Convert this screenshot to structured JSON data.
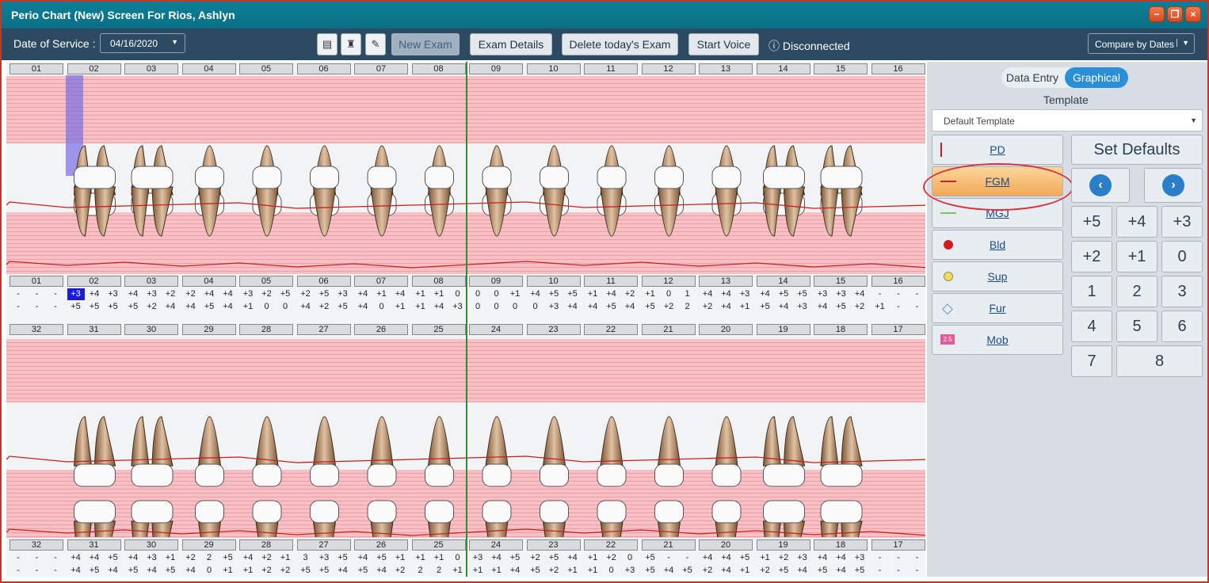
{
  "window": {
    "title": "Perio Chart (New) Screen For Rios, Ashlyn",
    "controls": [
      "−",
      "❐",
      "×"
    ]
  },
  "toolbar": {
    "date_label": "Date of Service :",
    "date_value": "04/16/2020",
    "new_exam": "New Exam",
    "exam_details": "Exam Details",
    "delete_exam": "Delete today's Exam",
    "start_voice": "Start Voice",
    "status": "Disconnected",
    "compare": "Compare by Dates"
  },
  "upper_teeth": [
    "01",
    "02",
    "03",
    "04",
    "05",
    "06",
    "07",
    "08",
    "09",
    "10",
    "11",
    "12",
    "13",
    "14",
    "15",
    "16"
  ],
  "lower_teeth": [
    "32",
    "31",
    "30",
    "29",
    "28",
    "27",
    "26",
    "25",
    "24",
    "23",
    "22",
    "21",
    "20",
    "19",
    "18",
    "17"
  ],
  "upper_row1": [
    "-",
    "-",
    "-",
    "+3",
    "+4",
    "+3",
    "+4",
    "+3",
    "+2",
    "+2",
    "+4",
    "+4",
    "+3",
    "+2",
    "+5",
    "+2",
    "+5",
    "+3",
    "+4",
    "+1",
    "+4",
    "+1",
    "+1",
    "0",
    "0",
    "0",
    "+1",
    "+4",
    "+5",
    "+5",
    "+1",
    "+4",
    "+2",
    "+1",
    "0",
    "1",
    "+4",
    "+4",
    "+3",
    "+4",
    "+5",
    "+5",
    "+3",
    "+3",
    "+4",
    "-",
    "-",
    "-"
  ],
  "upper_row2": [
    "-",
    "-",
    "-",
    "+5",
    "+5",
    "+5",
    "+5",
    "+2",
    "+4",
    "+4",
    "+5",
    "+4",
    "+1",
    "0",
    "0",
    "+4",
    "+2",
    "+5",
    "+4",
    "0",
    "+1",
    "+1",
    "+4",
    "+3",
    "0",
    "0",
    "0",
    "0",
    "+3",
    "+4",
    "+4",
    "+5",
    "+4",
    "+5",
    "+2",
    "2",
    "+2",
    "+4",
    "+1",
    "+5",
    "+4",
    "+3",
    "+4",
    "+5",
    "+2",
    "+1",
    "-",
    "-",
    "-"
  ],
  "lower_row1": [
    "-",
    "-",
    "-",
    "+4",
    "+4",
    "+5",
    "+4",
    "+3",
    "+1",
    "+2",
    "2",
    "+5",
    "+4",
    "+2",
    "+1",
    "3",
    "+3",
    "+5",
    "+4",
    "+5",
    "+1",
    "+1",
    "+1",
    "0",
    "+3",
    "+4",
    "+5",
    "+2",
    "+5",
    "+4",
    "+1",
    "+2",
    "0",
    "+5",
    "-",
    "-",
    "+4",
    "+4",
    "+5",
    "+1",
    "+2",
    "+3",
    "+4",
    "+4",
    "+3",
    "-",
    "-",
    "-"
  ],
  "lower_row2": [
    "-",
    "-",
    "-",
    "+4",
    "+5",
    "+4",
    "+5",
    "+4",
    "+5",
    "+4",
    "0",
    "+1",
    "+1",
    "+2",
    "+2",
    "+5",
    "+5",
    "+4",
    "+5",
    "+4",
    "+2",
    "2",
    "2",
    "+1",
    "+1",
    "+1",
    "+4",
    "+5",
    "+2",
    "+1",
    "+1",
    "0",
    "+3",
    "+5",
    "+4",
    "+5",
    "+2",
    "+4",
    "+1",
    "+2",
    "+5",
    "+4",
    "+5",
    "+4",
    "+5",
    "-",
    "-",
    "-"
  ],
  "panel": {
    "data_entry": "Data Entry",
    "graphical": "Graphical",
    "template_label": "Template",
    "template_value": "Default Template",
    "set_defaults": "Set Defaults",
    "tools": [
      "PD",
      "FGM",
      "MGJ",
      "Bld",
      "Sup",
      "Fur",
      "Mob"
    ],
    "keypad": [
      "+5",
      "+4",
      "+3",
      "+2",
      "+1",
      "0",
      "1",
      "2",
      "3",
      "4",
      "5",
      "6",
      "7",
      "8"
    ],
    "mob_badge": "2.5"
  },
  "colors": {
    "title_bg": "#0b6f85",
    "toolbar_bg": "#2d4a63",
    "band_pink": "#f8c0c4",
    "midline_green": "#2e8b2e",
    "active_tool": "#f4a857",
    "toggle_on": "#2a8fd6"
  }
}
